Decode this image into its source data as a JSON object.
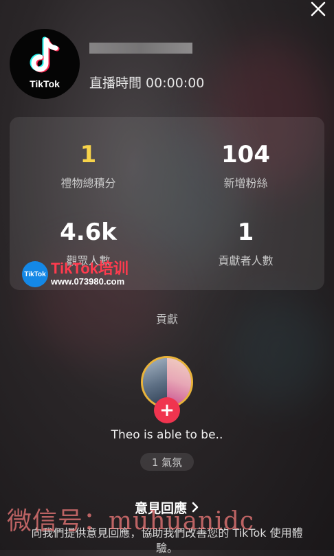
{
  "header": {
    "logo_text": "TikTok",
    "live_time": "直播時間 00:00:00"
  },
  "stats": [
    {
      "value": "1",
      "label": "禮物總積分",
      "highlight": "#f7d34a"
    },
    {
      "value": "104",
      "label": "新增粉絲"
    },
    {
      "value": "4.6k",
      "label": "觀眾人數"
    },
    {
      "value": "1",
      "label": "貢獻者人數"
    }
  ],
  "overlay_watermark": {
    "circle_text": "TikTok",
    "brand": "TikTok培训",
    "url": "www.073980.com"
  },
  "contributions": {
    "section_label": "貢獻",
    "contributor_name": "Theo is able to be..",
    "badge": "1 氣氛",
    "add_symbol": "+"
  },
  "feedback": {
    "title": "意見回應",
    "description": "向我們提供意見回應，協助我們改善您的 TikTok 使用體驗。"
  },
  "bottom_watermark": "微信号：muhuanidc",
  "colors": {
    "accent_pink": "#f0344f",
    "gold": "#f7d34a",
    "ring": "#e9b33a"
  }
}
